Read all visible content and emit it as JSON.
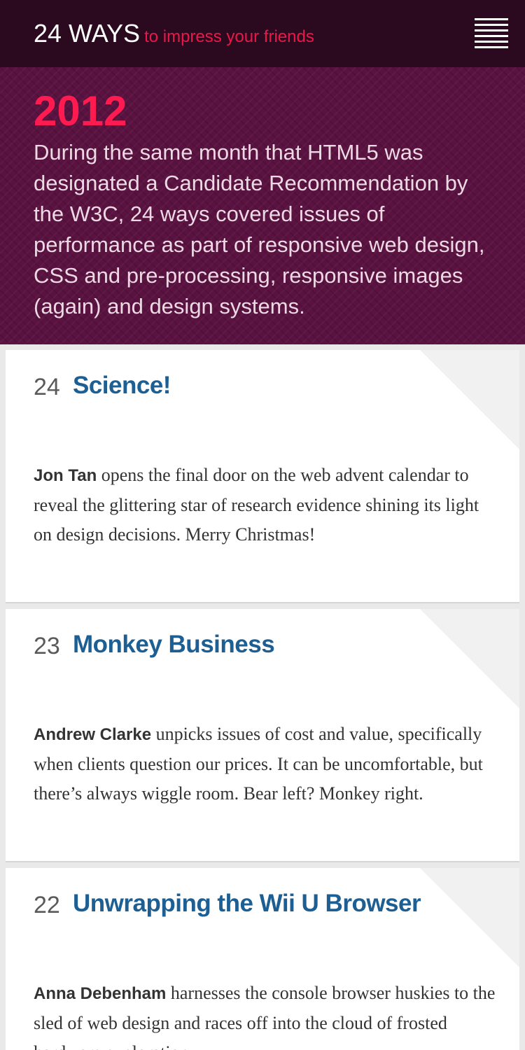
{
  "header": {
    "brand": "24 WAYS",
    "tagline": "to impress your friends",
    "menu_icon": "hamburger-menu-icon"
  },
  "hero": {
    "year": "2012",
    "description": "During the same month that HTML5 was designated a Candidate Recommendation by the W3C, 24 ways covered issues of performance as part of responsive web design, CSS and pre-processing, responsive images (again) and design systems."
  },
  "articles": [
    {
      "number": "24",
      "title": "Science!",
      "author": "Jon Tan",
      "excerpt": "opens the final door on the web advent calendar to reveal the glittering star of research evidence shining its light on design decisions. Merry Christmas!"
    },
    {
      "number": "23",
      "title": "Monkey Business",
      "author": "Andrew Clarke",
      "excerpt": "unpicks issues of cost and value, specifically when clients question our prices. It can be uncomfortable, but there’s always wiggle room. Bear left? Monkey right."
    },
    {
      "number": "22",
      "title": "Unwrapping the Wii U Browser",
      "author": "Anna Debenham",
      "excerpt": "harnesses the console browser huskies to the sled of web design and races off into the cloud of frosted hardware exploration."
    }
  ],
  "colors": {
    "header_bg": "#2b0a1f",
    "hero_bg": "#5a1240",
    "accent": "#ff1a4f",
    "link": "#1d5f93"
  }
}
